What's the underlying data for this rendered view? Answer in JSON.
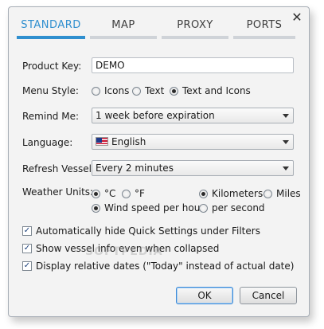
{
  "window": {
    "close_glyph": "✕"
  },
  "tabs": [
    {
      "label": "STANDARD",
      "active": true
    },
    {
      "label": "MAP",
      "active": false
    },
    {
      "label": "PROXY",
      "active": false
    },
    {
      "label": "PORTS",
      "active": false
    }
  ],
  "product_key": {
    "label": "Product Key:",
    "value": "DEMO"
  },
  "menu_style": {
    "label": "Menu Style:",
    "options": [
      "Icons",
      "Text",
      "Text and Icons"
    ],
    "selected": "Text and Icons"
  },
  "remind_me": {
    "label": "Remind Me:",
    "value": "1 week before expiration"
  },
  "language": {
    "label": "Language:",
    "value": "English",
    "flag_icon": "us-flag-icon"
  },
  "refresh_vessels": {
    "label": "Refresh Vessels:",
    "value": "Every 2 minutes"
  },
  "weather_units": {
    "label": "Weather Units:",
    "temp_options": [
      "°C",
      "°F"
    ],
    "temp_selected": "°C",
    "distance_options": [
      "Kilometers",
      "Miles"
    ],
    "distance_selected": "Kilometers",
    "wind_options": [
      "Wind speed per hour",
      "per second"
    ],
    "wind_selected": "Wind speed per hour"
  },
  "checkboxes": [
    {
      "label": "Automatically hide Quick Settings under Filters",
      "checked": true
    },
    {
      "label": "Show vessel info even when collapsed",
      "checked": true
    },
    {
      "label": "Display relative dates (\"Today\" instead of actual date)",
      "checked": true
    }
  ],
  "buttons": {
    "ok": "OK",
    "cancel": "Cancel"
  },
  "watermark": "SOFTPEDIA"
}
